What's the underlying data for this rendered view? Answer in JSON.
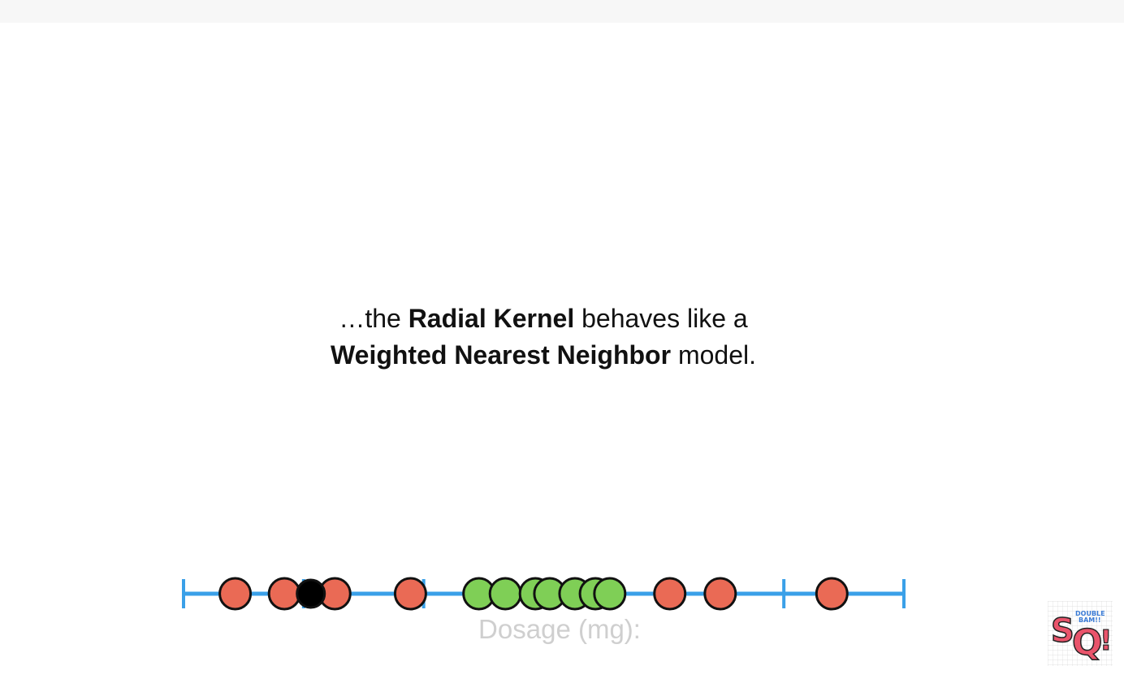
{
  "caption": {
    "line1_pre": "…the ",
    "line1_bold": "Radial Kernel",
    "line1_post": " behaves like a",
    "line2_bold": "Weighted Nearest Neighbor",
    "line2_post": " model."
  },
  "axis_label": "Dosage (mg):",
  "logo": {
    "text_main": "SQ!",
    "text_small": "DOUBLE BAM!!"
  },
  "colors": {
    "axis": "#3aa0e8",
    "red": "#ea6a55",
    "green": "#7fcf56",
    "new_point": "#000000",
    "outline": "#111111"
  },
  "chart_data": {
    "type": "scatter",
    "xlim": [
      0,
      6
    ],
    "ticks": [
      0,
      1,
      2,
      3,
      4,
      5,
      6
    ],
    "series": [
      {
        "class": "red",
        "x": [
          0.43,
          0.84,
          1.26,
          1.89,
          4.05,
          4.47,
          5.4
        ]
      },
      {
        "class": "green",
        "x": [
          2.46,
          2.68,
          2.93,
          3.05,
          3.26,
          3.43,
          3.55
        ]
      },
      {
        "class": "new",
        "x": [
          1.06
        ]
      }
    ]
  }
}
